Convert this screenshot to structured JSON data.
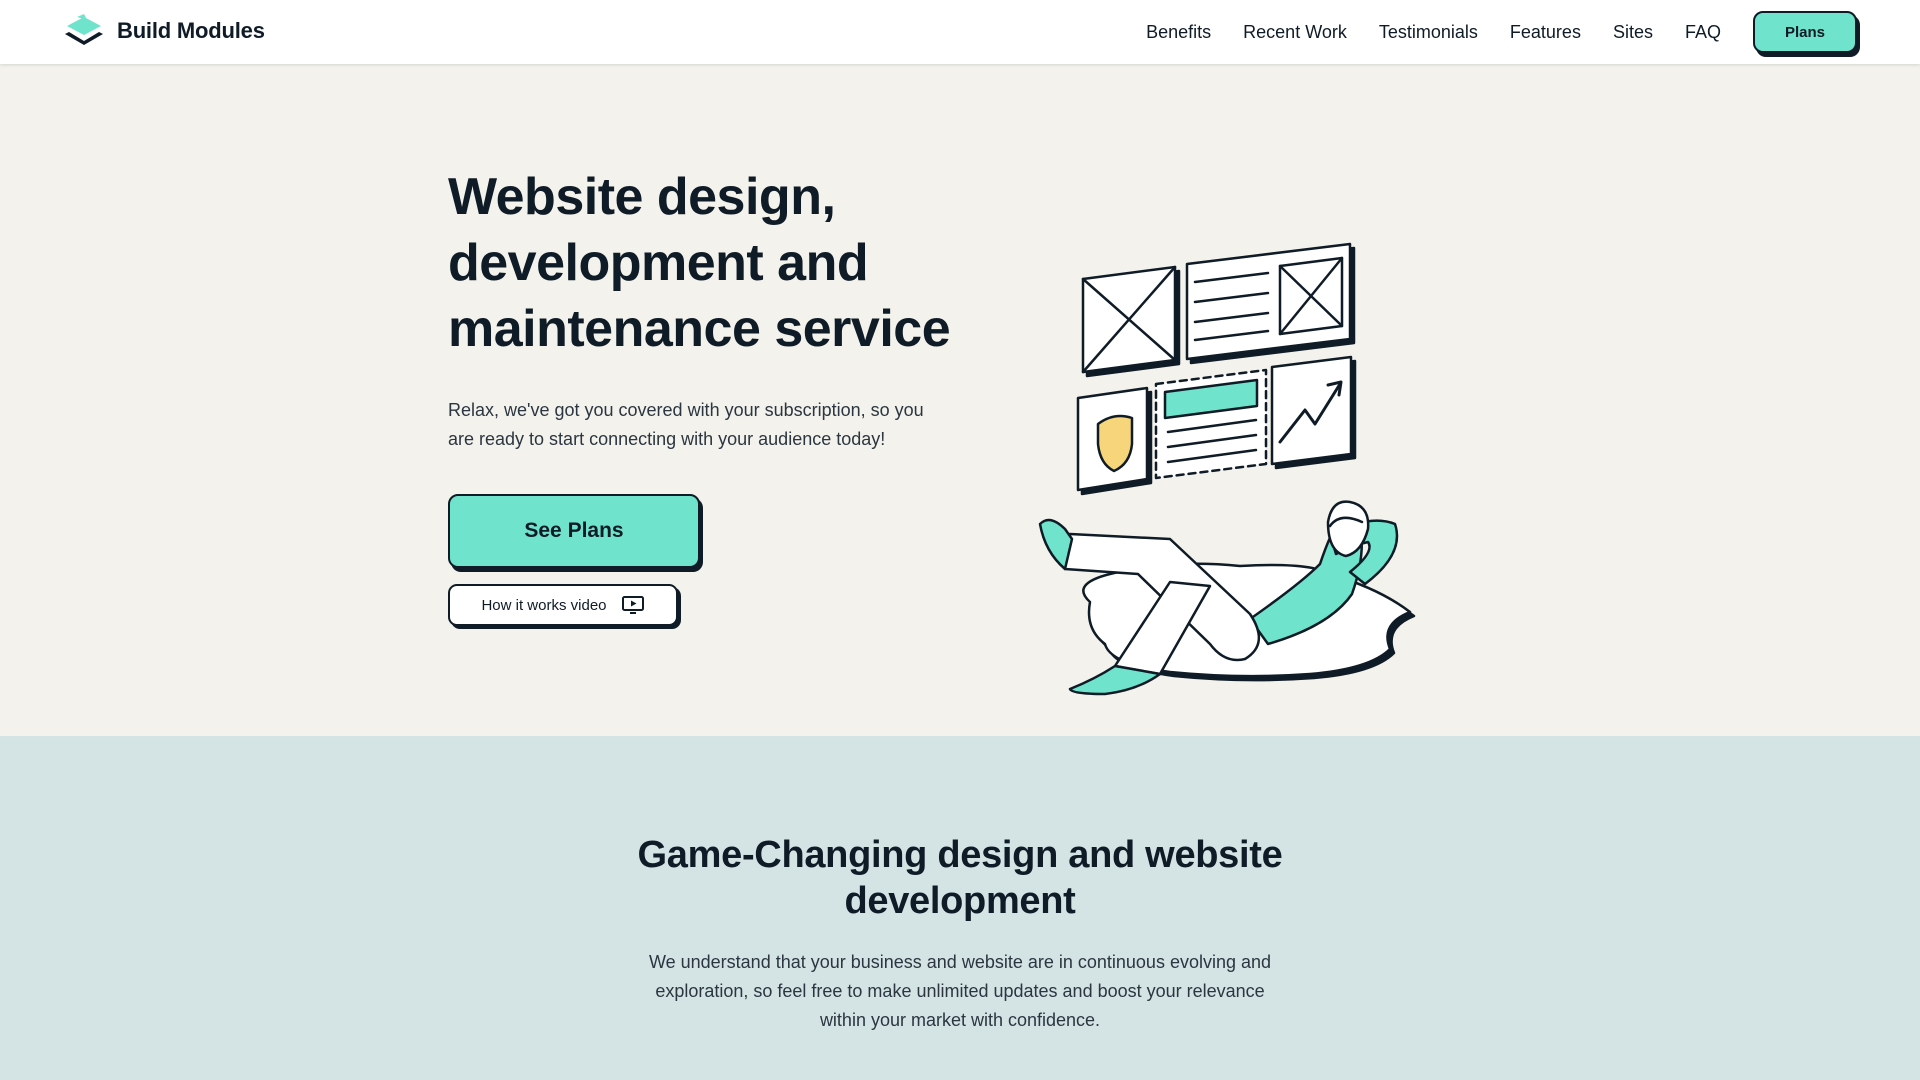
{
  "brand": {
    "name": "Build Modules",
    "logo_icon": "stacked-layers-icon",
    "accent_color": "#6fe3cc"
  },
  "nav": {
    "items": [
      "Benefits",
      "Recent Work",
      "Testimonials",
      "Features",
      "Sites",
      "FAQ"
    ],
    "cta_label": "Plans"
  },
  "hero": {
    "title": "Website design, development and maintenance service",
    "subtitle": "Relax, we've got you covered with your subscription, so you are ready to start connecting with your audience today!",
    "primary_button": "See Plans",
    "secondary_button": "How it works video",
    "secondary_icon": "play-video-icon",
    "illustration": "person-relaxing-with-wireframe-cards-illustration"
  },
  "section2": {
    "title": "Game-Changing design and website development",
    "body": "We understand that your business and website are in continuous evolving and exploration, so feel free to make unlimited updates and boost your relevance within your market with confidence."
  },
  "colors": {
    "dark": "#0f1b26",
    "hero_bg": "#f3f2ec",
    "section_bg": "#d4e4e5",
    "shield": "#f7d57a"
  }
}
